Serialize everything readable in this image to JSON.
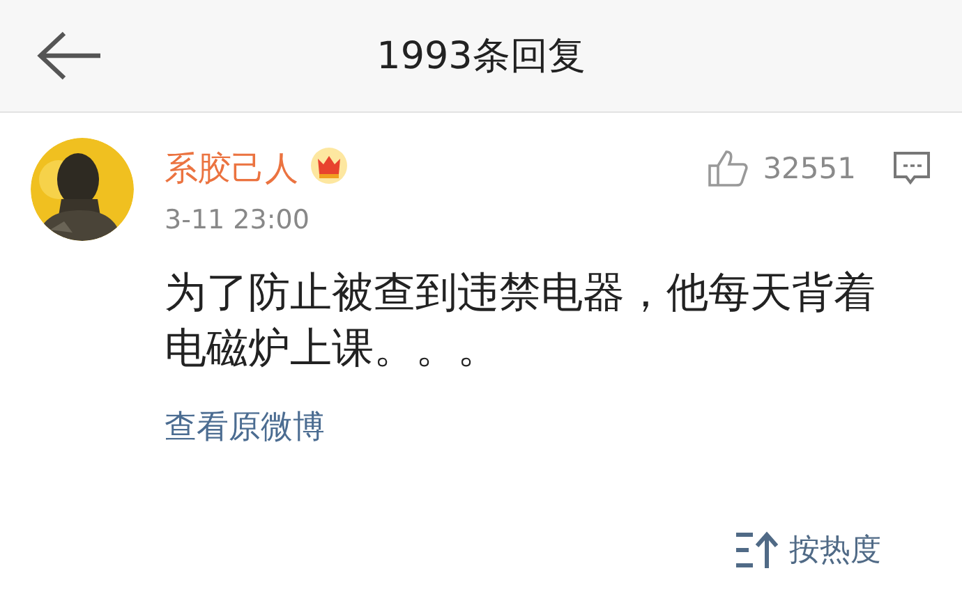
{
  "header": {
    "title": "1993条回复"
  },
  "comment": {
    "author": "系胶己人",
    "time": "3-11 23:00",
    "likes": "32551",
    "text": "为了防止被查到违禁电器，他每天背着电磁炉上课。。。",
    "link": "查看原微博"
  },
  "sort": {
    "label": "按热度"
  }
}
